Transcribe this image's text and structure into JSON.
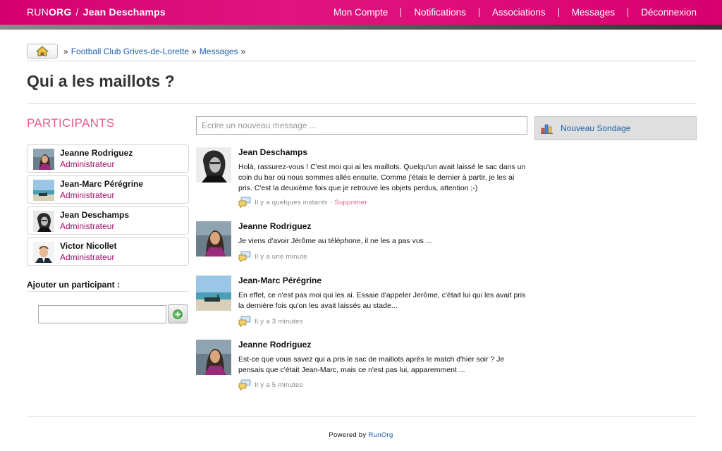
{
  "header": {
    "brand_run": "RUN",
    "brand_org": "ORG",
    "brand_sep": "/",
    "user_name": "Jean Deschamps",
    "nav": [
      "Mon Compte",
      "Notifications",
      "Associations",
      "Messages",
      "Déconnexion"
    ]
  },
  "breadcrumb": {
    "home_icon": "home-icon",
    "sep": "»",
    "items": [
      "Football Club Grives-de-Lorette",
      "Messages"
    ]
  },
  "page_title": "Qui a les maillots ?",
  "participants": {
    "title": "PARTICIPANTS",
    "items": [
      {
        "name": "Jeanne Rodriguez",
        "role": "Administrateur"
      },
      {
        "name": "Jean-Marc Pérégrine",
        "role": "Administrateur"
      },
      {
        "name": "Jean Deschamps",
        "role": "Administrateur"
      },
      {
        "name": "Victor Nicollet",
        "role": "Administrateur"
      }
    ],
    "add_label": "Ajouter un participant :",
    "add_value": ""
  },
  "composer": {
    "placeholder": "Ecrire un nouveau message ..."
  },
  "messages": [
    {
      "author": "Jean Deschamps",
      "body": "Holà, rassurez-vous ! C'est moi qui ai les maillots. Quelqu'un avait laissé le sac dans un coin du bar où nous sommes allés ensuite. Comme j'étais le dernier à partir, je les ai pris. C'est la deuxième fois que je retrouve les objets perdus, attention ;-)",
      "time": "Il y a quelques instants",
      "meta_sep": "·",
      "delete": "Supprimer"
    },
    {
      "author": "Jeanne Rodriguez",
      "body": "Je viens d'avoir Jérôme au téléphone, il ne les a pas vus ...",
      "time": "Il y a une minute"
    },
    {
      "author": "Jean-Marc Pérégrine",
      "body": "En effet, ce n'est pas moi qui les ai. Essaie d'appeler Jerôme, c'était lui qui les avait pris la dernière fois qu'on les avait laissés au stade...",
      "time": "Il y a 3 minutes"
    },
    {
      "author": "Jeanne Rodriguez",
      "body": "Est-ce que vous savez qui a pris le sac de maillots après le match d'hier soir ? Je pensais que c'était Jean-Marc, mais ce n'est pas lui, apparemment ...",
      "time": "Il y a 5 minutes"
    }
  ],
  "sidebar": {
    "poll_label": "Nouveau Sondage"
  },
  "footer": {
    "prefix": "Powered by",
    "link": "RunOrg"
  },
  "colors": {
    "brand_pink": "#d4006e",
    "accent_pink": "#e8588f",
    "role_color": "#a0106a",
    "link_blue": "#1b5fa6"
  }
}
